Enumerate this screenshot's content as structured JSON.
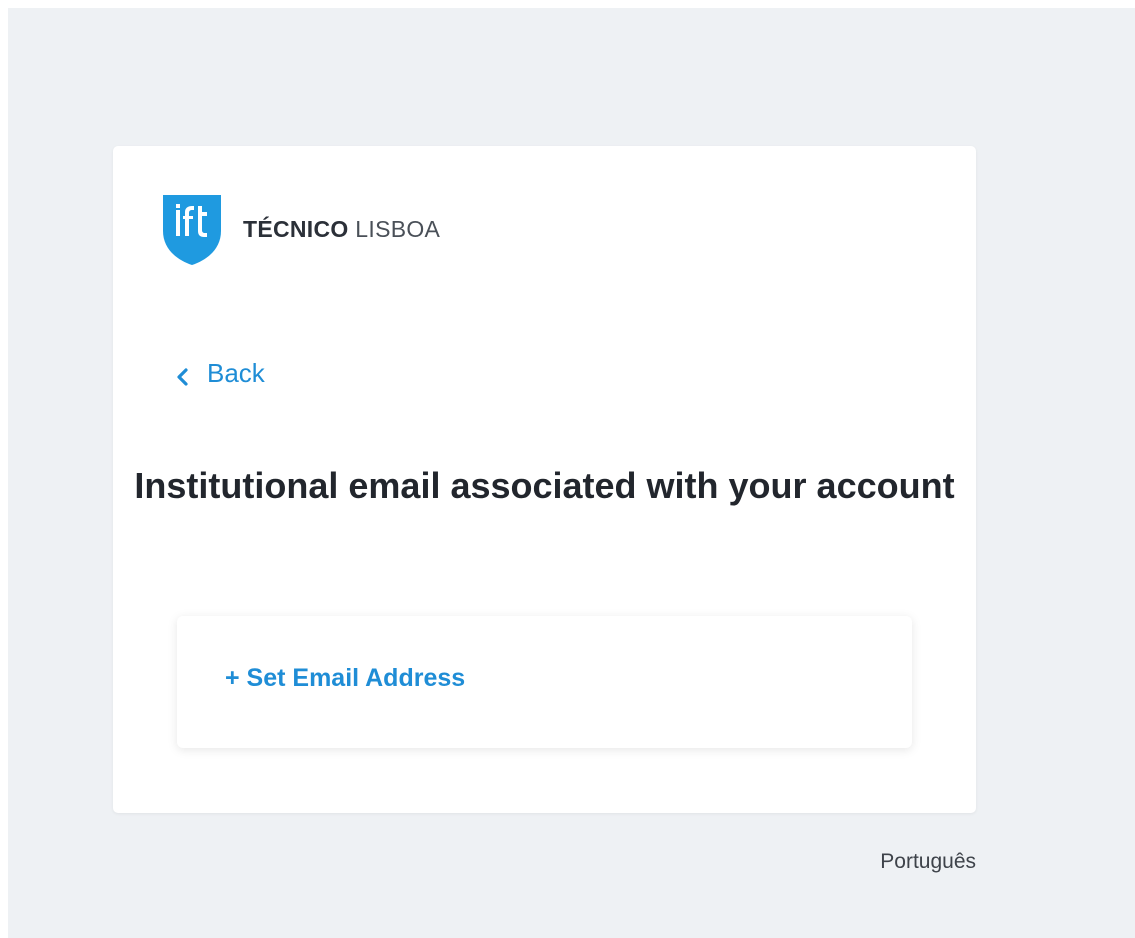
{
  "brand": {
    "logo_icon": "ist-shield-logo",
    "name_bold": "TÉCNICO",
    "name_light": " LISBOA",
    "logo_color": "#1f9ae0"
  },
  "nav": {
    "back_label": "Back",
    "back_icon": "chevron-left-icon"
  },
  "main": {
    "title": "Institutional email associated with your account",
    "set_email_label": "+ Set Email Address"
  },
  "footer": {
    "language_label": "Português"
  },
  "colors": {
    "accent": "#1f8dd6",
    "background": "#eef1f4",
    "card": "#ffffff",
    "title_text": "#22262d"
  }
}
